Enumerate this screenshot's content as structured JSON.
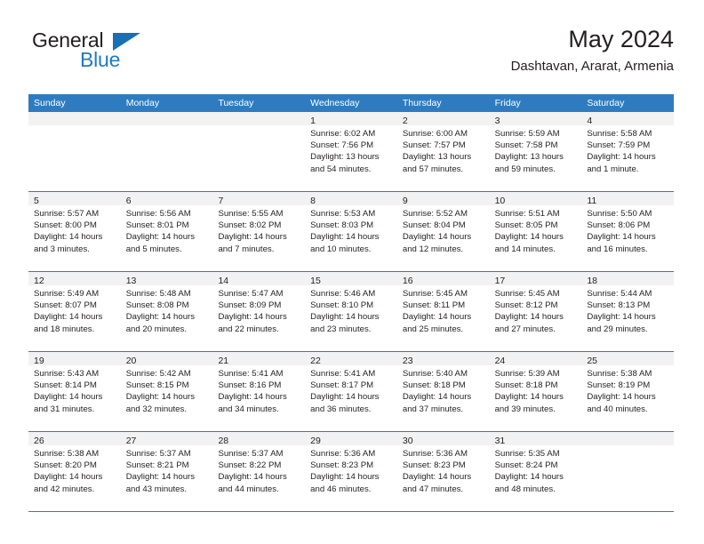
{
  "brand": {
    "word_general": "General",
    "word_blue": "Blue",
    "triangle_color": "#1a6fb5",
    "blue_color": "#1f7ac4"
  },
  "header": {
    "title": "May 2024",
    "subtitle": "Dashtavan, Ararat, Armenia",
    "accent_color": "#2e7cbf",
    "strip_color": "#f2f2f2"
  },
  "weekdays": [
    "Sunday",
    "Monday",
    "Tuesday",
    "Wednesday",
    "Thursday",
    "Friday",
    "Saturday"
  ],
  "weeks": [
    [
      {
        "day": "",
        "lines": []
      },
      {
        "day": "",
        "lines": []
      },
      {
        "day": "",
        "lines": []
      },
      {
        "day": "1",
        "lines": [
          "Sunrise: 6:02 AM",
          "Sunset: 7:56 PM",
          "Daylight: 13 hours",
          "and 54 minutes."
        ]
      },
      {
        "day": "2",
        "lines": [
          "Sunrise: 6:00 AM",
          "Sunset: 7:57 PM",
          "Daylight: 13 hours",
          "and 57 minutes."
        ]
      },
      {
        "day": "3",
        "lines": [
          "Sunrise: 5:59 AM",
          "Sunset: 7:58 PM",
          "Daylight: 13 hours",
          "and 59 minutes."
        ]
      },
      {
        "day": "4",
        "lines": [
          "Sunrise: 5:58 AM",
          "Sunset: 7:59 PM",
          "Daylight: 14 hours",
          "and 1 minute."
        ]
      }
    ],
    [
      {
        "day": "5",
        "lines": [
          "Sunrise: 5:57 AM",
          "Sunset: 8:00 PM",
          "Daylight: 14 hours",
          "and 3 minutes."
        ]
      },
      {
        "day": "6",
        "lines": [
          "Sunrise: 5:56 AM",
          "Sunset: 8:01 PM",
          "Daylight: 14 hours",
          "and 5 minutes."
        ]
      },
      {
        "day": "7",
        "lines": [
          "Sunrise: 5:55 AM",
          "Sunset: 8:02 PM",
          "Daylight: 14 hours",
          "and 7 minutes."
        ]
      },
      {
        "day": "8",
        "lines": [
          "Sunrise: 5:53 AM",
          "Sunset: 8:03 PM",
          "Daylight: 14 hours",
          "and 10 minutes."
        ]
      },
      {
        "day": "9",
        "lines": [
          "Sunrise: 5:52 AM",
          "Sunset: 8:04 PM",
          "Daylight: 14 hours",
          "and 12 minutes."
        ]
      },
      {
        "day": "10",
        "lines": [
          "Sunrise: 5:51 AM",
          "Sunset: 8:05 PM",
          "Daylight: 14 hours",
          "and 14 minutes."
        ]
      },
      {
        "day": "11",
        "lines": [
          "Sunrise: 5:50 AM",
          "Sunset: 8:06 PM",
          "Daylight: 14 hours",
          "and 16 minutes."
        ]
      }
    ],
    [
      {
        "day": "12",
        "lines": [
          "Sunrise: 5:49 AM",
          "Sunset: 8:07 PM",
          "Daylight: 14 hours",
          "and 18 minutes."
        ]
      },
      {
        "day": "13",
        "lines": [
          "Sunrise: 5:48 AM",
          "Sunset: 8:08 PM",
          "Daylight: 14 hours",
          "and 20 minutes."
        ]
      },
      {
        "day": "14",
        "lines": [
          "Sunrise: 5:47 AM",
          "Sunset: 8:09 PM",
          "Daylight: 14 hours",
          "and 22 minutes."
        ]
      },
      {
        "day": "15",
        "lines": [
          "Sunrise: 5:46 AM",
          "Sunset: 8:10 PM",
          "Daylight: 14 hours",
          "and 23 minutes."
        ]
      },
      {
        "day": "16",
        "lines": [
          "Sunrise: 5:45 AM",
          "Sunset: 8:11 PM",
          "Daylight: 14 hours",
          "and 25 minutes."
        ]
      },
      {
        "day": "17",
        "lines": [
          "Sunrise: 5:45 AM",
          "Sunset: 8:12 PM",
          "Daylight: 14 hours",
          "and 27 minutes."
        ]
      },
      {
        "day": "18",
        "lines": [
          "Sunrise: 5:44 AM",
          "Sunset: 8:13 PM",
          "Daylight: 14 hours",
          "and 29 minutes."
        ]
      }
    ],
    [
      {
        "day": "19",
        "lines": [
          "Sunrise: 5:43 AM",
          "Sunset: 8:14 PM",
          "Daylight: 14 hours",
          "and 31 minutes."
        ]
      },
      {
        "day": "20",
        "lines": [
          "Sunrise: 5:42 AM",
          "Sunset: 8:15 PM",
          "Daylight: 14 hours",
          "and 32 minutes."
        ]
      },
      {
        "day": "21",
        "lines": [
          "Sunrise: 5:41 AM",
          "Sunset: 8:16 PM",
          "Daylight: 14 hours",
          "and 34 minutes."
        ]
      },
      {
        "day": "22",
        "lines": [
          "Sunrise: 5:41 AM",
          "Sunset: 8:17 PM",
          "Daylight: 14 hours",
          "and 36 minutes."
        ]
      },
      {
        "day": "23",
        "lines": [
          "Sunrise: 5:40 AM",
          "Sunset: 8:18 PM",
          "Daylight: 14 hours",
          "and 37 minutes."
        ]
      },
      {
        "day": "24",
        "lines": [
          "Sunrise: 5:39 AM",
          "Sunset: 8:18 PM",
          "Daylight: 14 hours",
          "and 39 minutes."
        ]
      },
      {
        "day": "25",
        "lines": [
          "Sunrise: 5:38 AM",
          "Sunset: 8:19 PM",
          "Daylight: 14 hours",
          "and 40 minutes."
        ]
      }
    ],
    [
      {
        "day": "26",
        "lines": [
          "Sunrise: 5:38 AM",
          "Sunset: 8:20 PM",
          "Daylight: 14 hours",
          "and 42 minutes."
        ]
      },
      {
        "day": "27",
        "lines": [
          "Sunrise: 5:37 AM",
          "Sunset: 8:21 PM",
          "Daylight: 14 hours",
          "and 43 minutes."
        ]
      },
      {
        "day": "28",
        "lines": [
          "Sunrise: 5:37 AM",
          "Sunset: 8:22 PM",
          "Daylight: 14 hours",
          "and 44 minutes."
        ]
      },
      {
        "day": "29",
        "lines": [
          "Sunrise: 5:36 AM",
          "Sunset: 8:23 PM",
          "Daylight: 14 hours",
          "and 46 minutes."
        ]
      },
      {
        "day": "30",
        "lines": [
          "Sunrise: 5:36 AM",
          "Sunset: 8:23 PM",
          "Daylight: 14 hours",
          "and 47 minutes."
        ]
      },
      {
        "day": "31",
        "lines": [
          "Sunrise: 5:35 AM",
          "Sunset: 8:24 PM",
          "Daylight: 14 hours",
          "and 48 minutes."
        ]
      },
      {
        "day": "",
        "lines": []
      }
    ]
  ]
}
